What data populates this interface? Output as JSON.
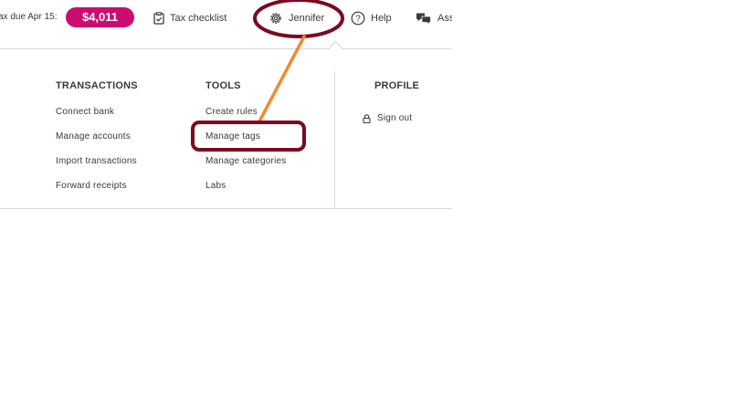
{
  "topbar": {
    "tax_due_label": "ax due Apr 15:",
    "tax_amount": "$4,011",
    "tax_checklist": "Tax checklist",
    "user_name": "Jennifer",
    "help": "Help",
    "assistant": "Ass"
  },
  "menu": {
    "transactions": {
      "heading": "TRANSACTIONS",
      "items": [
        "Connect bank",
        "Manage accounts",
        "Import transactions",
        "Forward receipts"
      ]
    },
    "tools": {
      "heading": "TOOLS",
      "items": [
        "Create rules",
        "Manage tags",
        "Manage categories",
        "Labs"
      ]
    },
    "profile": {
      "heading": "PROFILE",
      "sign_out": "Sign out"
    }
  },
  "colors": {
    "tax_badge": "#cc0b73",
    "annotation_circle": "#7b0b1f",
    "annotation_arrow": "#f28a2e"
  }
}
